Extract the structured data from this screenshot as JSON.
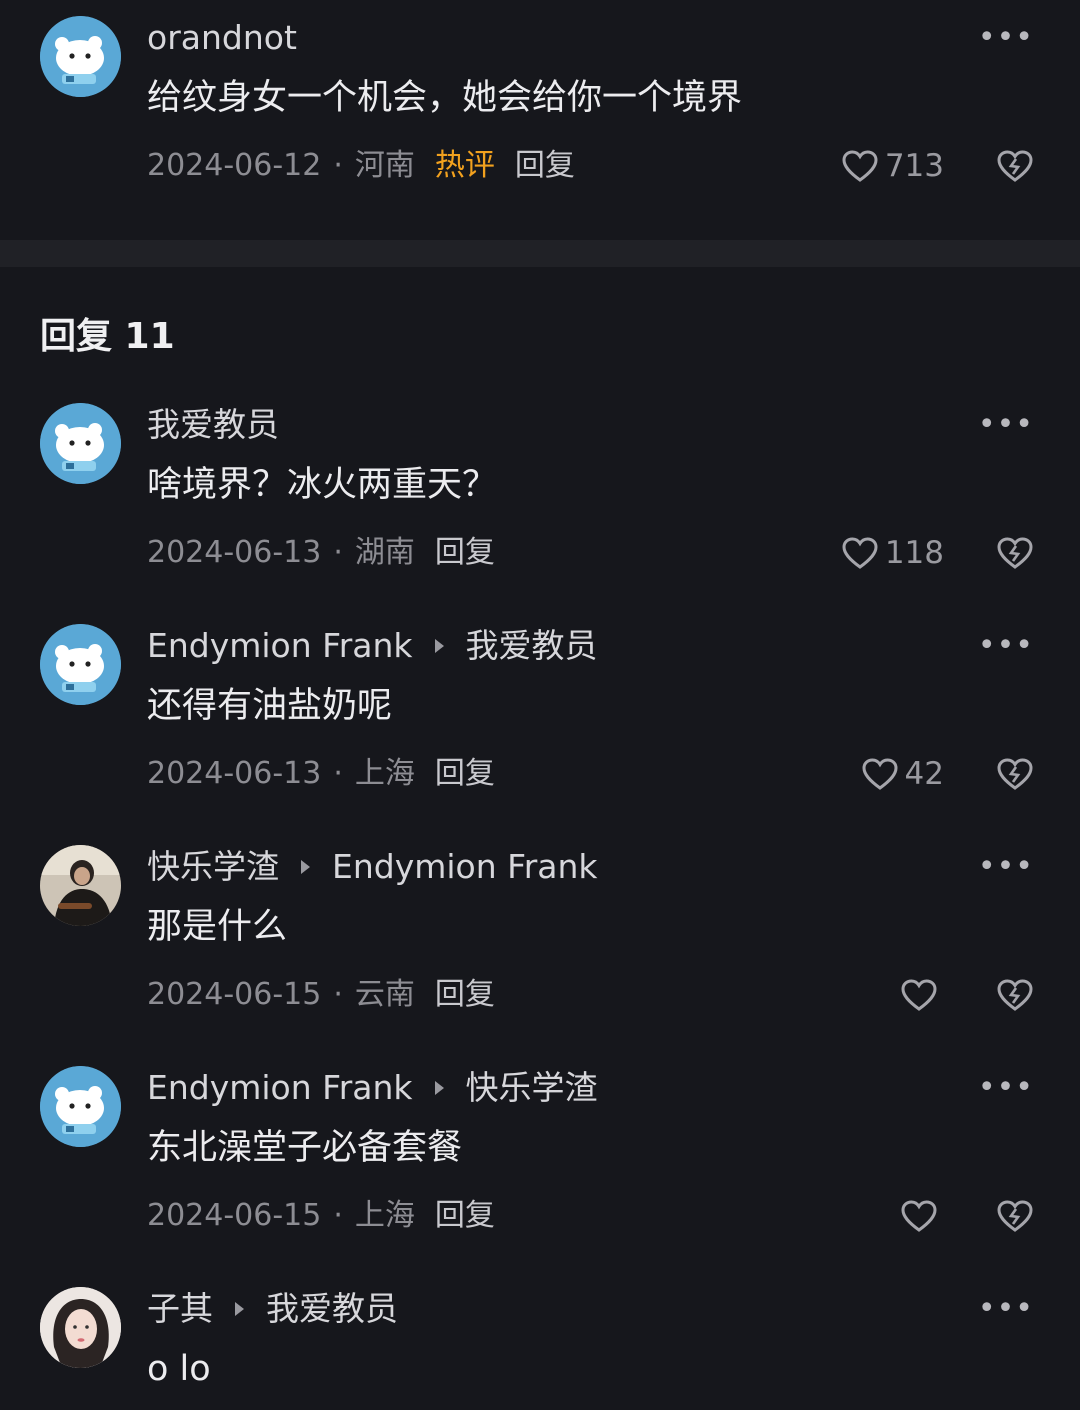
{
  "main_comment": {
    "user": "orandnot",
    "text": "给纹身女一个机会，她会给你一个境界",
    "date": "2024-06-12",
    "location": "河南",
    "hot_badge": "热评",
    "reply_label": "回复",
    "likes": "713",
    "more_icon": "more-dots-icon"
  },
  "replies_header": "回复 11",
  "replies": [
    {
      "user": "我爱教员",
      "reply_to": "",
      "text": "啥境界？冰火两重天？",
      "date": "2024-06-13",
      "location": "湖南",
      "reply_label": "回复",
      "likes": "118",
      "avatar": "bear-avatar"
    },
    {
      "user": "Endymion Frank",
      "reply_to": "我爱教员",
      "text": "还得有油盐奶呢",
      "date": "2024-06-13",
      "location": "上海",
      "reply_label": "回复",
      "likes": "42",
      "avatar": "bear-avatar"
    },
    {
      "user": "快乐学渣",
      "reply_to": "Endymion Frank",
      "text": "那是什么",
      "date": "2024-06-15",
      "location": "云南",
      "reply_label": "回复",
      "likes": "",
      "avatar": "photo-avatar"
    },
    {
      "user": "Endymion Frank",
      "reply_to": "快乐学渣",
      "text": "东北澡堂子必备套餐",
      "date": "2024-06-15",
      "location": "上海",
      "reply_label": "回复",
      "likes": "",
      "avatar": "bear-avatar"
    },
    {
      "user": "子其",
      "reply_to": "我爱教员",
      "text": "o lo",
      "avatar": "girl-avatar"
    }
  ],
  "colors": {
    "background": "#16171c",
    "hot": "#f2a11e",
    "avatar_blue": "#5aa8d6"
  }
}
